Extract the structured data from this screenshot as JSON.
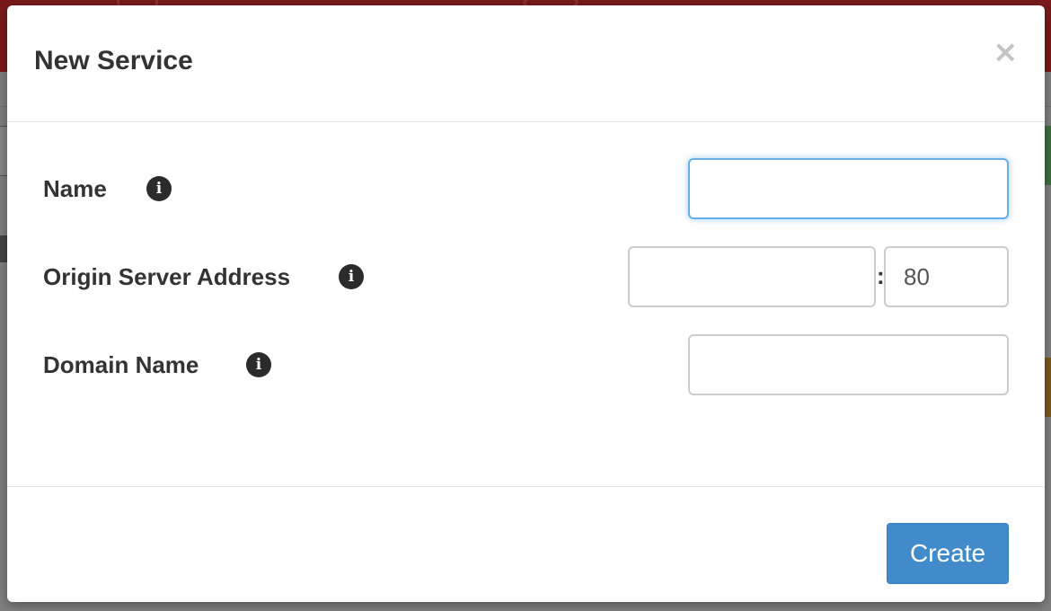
{
  "modal": {
    "title": "New Service",
    "close_label": "×"
  },
  "form": {
    "name": {
      "label": "Name",
      "info_icon": "i",
      "value": ""
    },
    "origin_server": {
      "label": "Origin Server Address",
      "info_icon": "i",
      "address_value": "",
      "separator": ":",
      "port_value": "80"
    },
    "domain_name": {
      "label": "Domain Name",
      "info_icon": "i",
      "value": ""
    }
  },
  "footer": {
    "create_label": "Create"
  },
  "colors": {
    "primary": "#428bca",
    "focus": "#66afe9",
    "text": "#333333"
  }
}
